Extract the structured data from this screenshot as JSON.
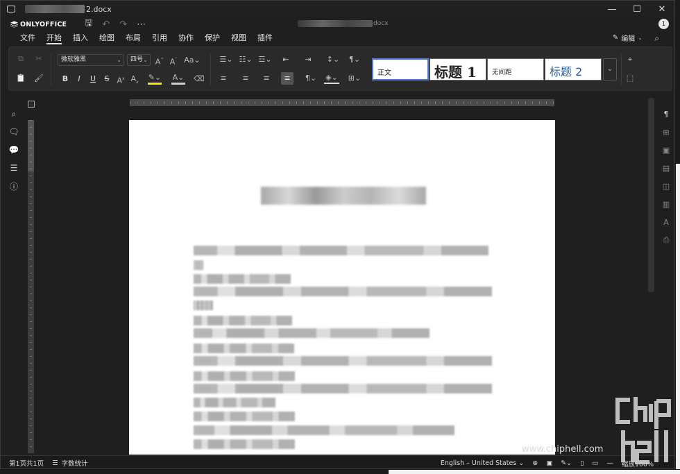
{
  "window": {
    "file_suffix": "2.docx",
    "doc_title_ext": "docx",
    "controls": {
      "minimize": "—",
      "maximize": "☐",
      "close": "✕"
    }
  },
  "header": {
    "brand": "ONLYOFFICE",
    "user_count": "1"
  },
  "menu": {
    "tabs": [
      "文件",
      "开始",
      "插入",
      "绘图",
      "布局",
      "引用",
      "协作",
      "保护",
      "视图",
      "插件"
    ],
    "active_tab": "开始",
    "edit_mode": "编辑"
  },
  "toolbar": {
    "font_name": "微软雅黑",
    "font_size": "四号",
    "styles": {
      "normal": "正文",
      "heading1": "标题 1",
      "no_spacing": "无间距",
      "heading2": "标题 2"
    }
  },
  "status": {
    "page_info": "第1页共1页",
    "word_count": "字数统计",
    "language": "English – United States",
    "zoom": "缩放100%"
  },
  "watermark": {
    "text": "chip hell",
    "url": "www.chiphell.com"
  }
}
